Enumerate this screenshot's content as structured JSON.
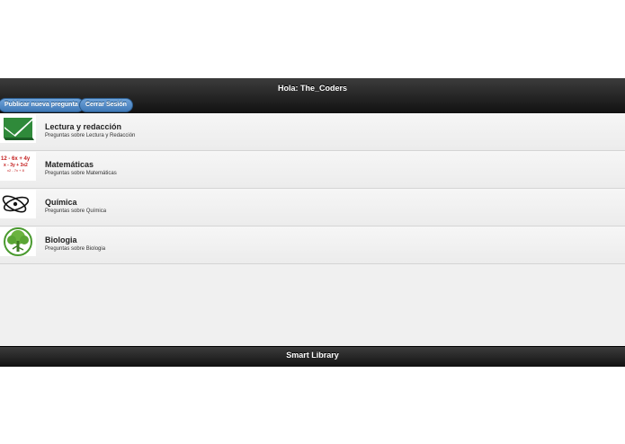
{
  "header": {
    "title": "Hola: The_Coders",
    "buttons": {
      "publish_label": "Publicar nueva pregunta",
      "logout_label": "Cerrar Sesión"
    }
  },
  "categories": [
    {
      "title": "Lectura y redacción",
      "description": "Preguntas sobre Lectura y Redacción",
      "icon": "book-icon"
    },
    {
      "title": "Matemáticas",
      "description": "Preguntas sobre Matemáticas",
      "icon": "math-formula-icon",
      "icon_text": [
        "12 - 6x + 4y",
        "x - 3y + 3x2",
        "x2 - 7x + 8"
      ]
    },
    {
      "title": "Química",
      "description": "Preguntas sobre Química",
      "icon": "atom-icon"
    },
    {
      "title": "Biologia",
      "description": "Preguntas sobre Biologia",
      "icon": "tree-icon"
    }
  ],
  "footer": {
    "title": "Smart Library"
  },
  "colors": {
    "bar_dark": "#111111",
    "button_blue": "#4f88c6",
    "list_bg": "#f0f0f0"
  }
}
